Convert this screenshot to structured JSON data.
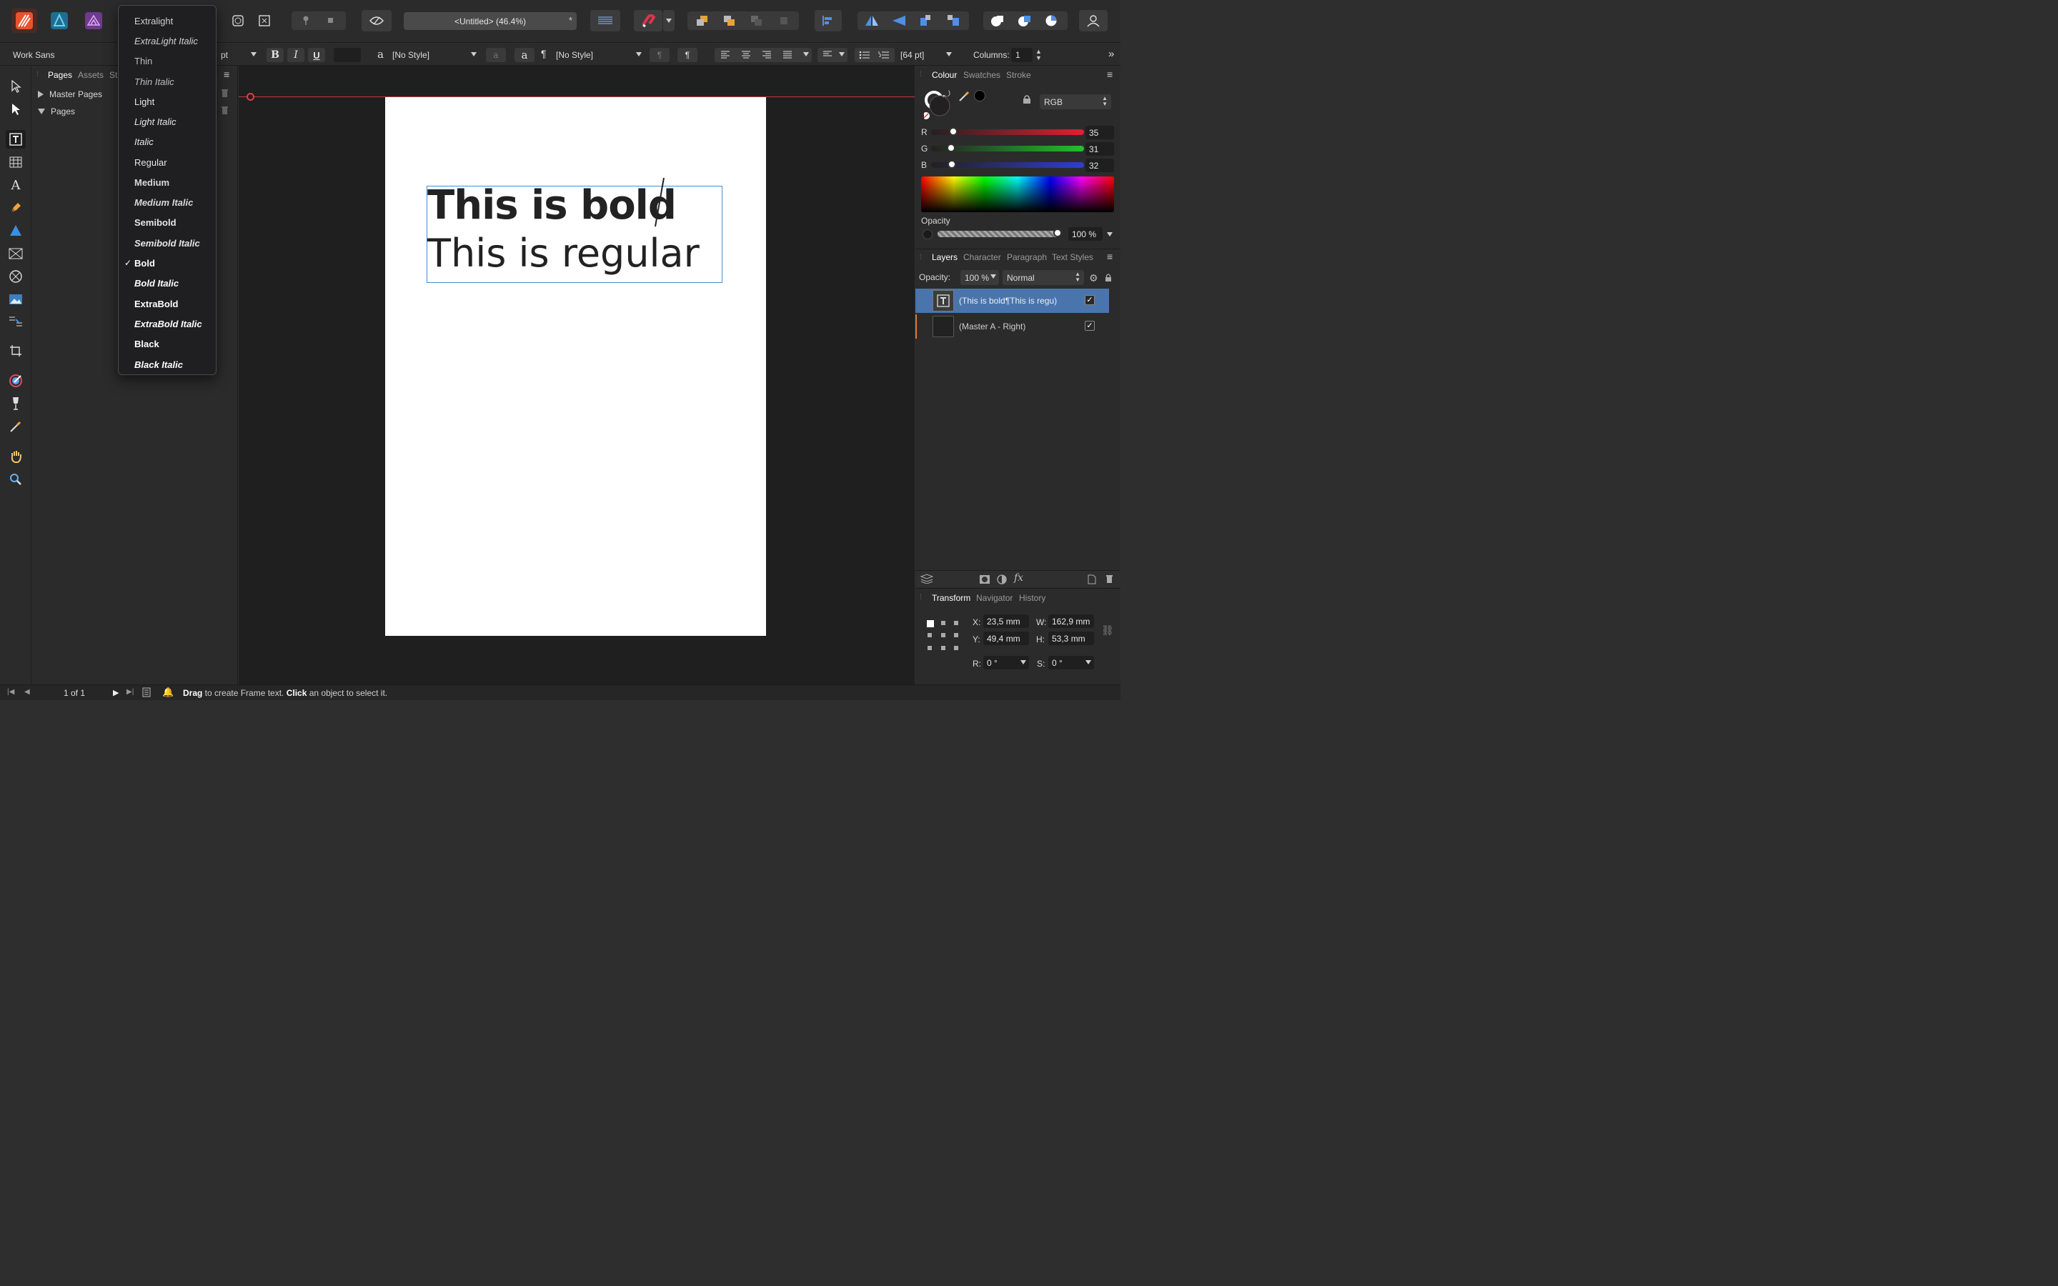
{
  "app": {
    "doc_title": "<Untitled> (46.4%)",
    "dirty_mark": "*"
  },
  "context": {
    "font_family": "Work Sans",
    "font_size_unit": "pt",
    "bold": "B",
    "italic": "I",
    "underline": "U",
    "char_style_prefix": "a",
    "char_style": "[No Style]",
    "para_style_prefix": "¶",
    "para_style": "[No Style]",
    "leading": "[64 pt]",
    "columns_label": "Columns:",
    "columns_value": "1"
  },
  "font_menu": {
    "items": [
      {
        "label": "Extralight"
      },
      {
        "label": "ExtraLight Italic"
      },
      {
        "label": "Thin"
      },
      {
        "label": "Thin Italic"
      },
      {
        "label": "Light"
      },
      {
        "label": "Light Italic"
      },
      {
        "label": "Italic"
      },
      {
        "label": "Regular"
      },
      {
        "label": "Medium"
      },
      {
        "label": "Medium Italic"
      },
      {
        "label": "Semibold"
      },
      {
        "label": "Semibold Italic"
      },
      {
        "label": "Bold"
      },
      {
        "label": "Bold Italic"
      },
      {
        "label": "ExtraBold"
      },
      {
        "label": "ExtraBold Italic"
      },
      {
        "label": "Black"
      },
      {
        "label": "Black Italic"
      }
    ],
    "checked_mark": "✓"
  },
  "pages_panel": {
    "tabs": [
      "Pages",
      "Assets",
      "St"
    ],
    "tree": [
      "Master Pages",
      "Pages"
    ]
  },
  "canvas": {
    "line_bold": "This is bold",
    "line_regular": "This is regular"
  },
  "colour_panel": {
    "tabs": [
      "Colour",
      "Swatches",
      "Stroke"
    ],
    "model": "RGB",
    "channels": [
      {
        "label": "R",
        "value": "35",
        "level": 0.137
      },
      {
        "label": "G",
        "value": "31",
        "level": 0.122
      },
      {
        "label": "B",
        "value": "32",
        "level": 0.125
      }
    ],
    "opacity_label": "Opacity",
    "opacity_value": "100 %"
  },
  "layers_panel": {
    "tabs": [
      "Layers",
      "Character",
      "Paragraph",
      "Text Styles"
    ],
    "opacity_label": "Opacity:",
    "opacity_value": "100 %",
    "blend": "Normal",
    "layers": [
      {
        "name": "(This is bold¶This is regu)",
        "check": "✓"
      },
      {
        "name": "(Master A - Right)",
        "check": "✓"
      }
    ]
  },
  "transform_panel": {
    "tabs": [
      "Transform",
      "Navigator",
      "History"
    ],
    "x_label": "X:",
    "x_value": "23,5 mm",
    "y_label": "Y:",
    "y_value": "49,4 mm",
    "w_label": "W:",
    "w_value": "162,9 mm",
    "h_label": "H:",
    "h_value": "53,3 mm",
    "r_label": "R:",
    "r_value": "0 °",
    "s_label": "S:",
    "s_value": "0 °"
  },
  "status": {
    "page_count": "1 of 1",
    "hint_drag": "Drag",
    "hint_mid": " to create Frame text. ",
    "hint_click": "Click",
    "hint_end": " an object to select it."
  }
}
